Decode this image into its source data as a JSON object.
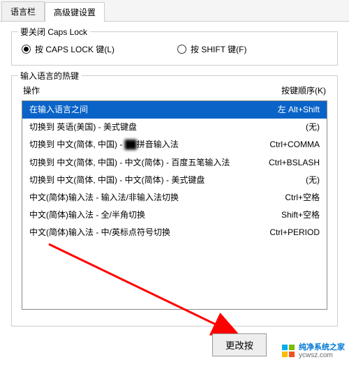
{
  "tabs": {
    "lang_bar": "语言栏",
    "advanced": "高级键设置"
  },
  "capslock_group": {
    "title": "要关闭 Caps Lock",
    "opt_caps": "按 CAPS LOCK 键(L)",
    "opt_shift": "按 SHIFT 键(F)"
  },
  "hotkey_group": {
    "title": "输入语言的热键",
    "col_action": "操作",
    "col_keys": "按键顺序(K)",
    "rows": [
      {
        "action": "在输入语言之间",
        "keys": "左 Alt+Shift",
        "selected": true
      },
      {
        "action": "切换到 英语(美国) - 美式键盘",
        "keys": "(无)"
      },
      {
        "action_a": "切换到 中文(简体, 中国) - ",
        "action_b": "拼音输入法",
        "keys": "Ctrl+COMMA",
        "blur": true
      },
      {
        "action": "切换到 中文(简体, 中国) - 中文(简体) - 百度五笔输入法",
        "keys": "Ctrl+BSLASH"
      },
      {
        "action": "切换到 中文(简体, 中国) - 中文(简体) - 美式键盘",
        "keys": "(无)"
      },
      {
        "action": "中文(简体)输入法 - 输入法/非输入法切换",
        "keys": "Ctrl+空格"
      },
      {
        "action": "中文(简体)输入法 - 全/半角切换",
        "keys": "Shift+空格"
      },
      {
        "action": "中文(简体)输入法 - 中/英标点符号切换",
        "keys": "Ctrl+PERIOD"
      }
    ]
  },
  "button": {
    "change": "更改按"
  },
  "watermark": {
    "line1": "纯净系统之家",
    "line2": "ycwsz.com"
  }
}
